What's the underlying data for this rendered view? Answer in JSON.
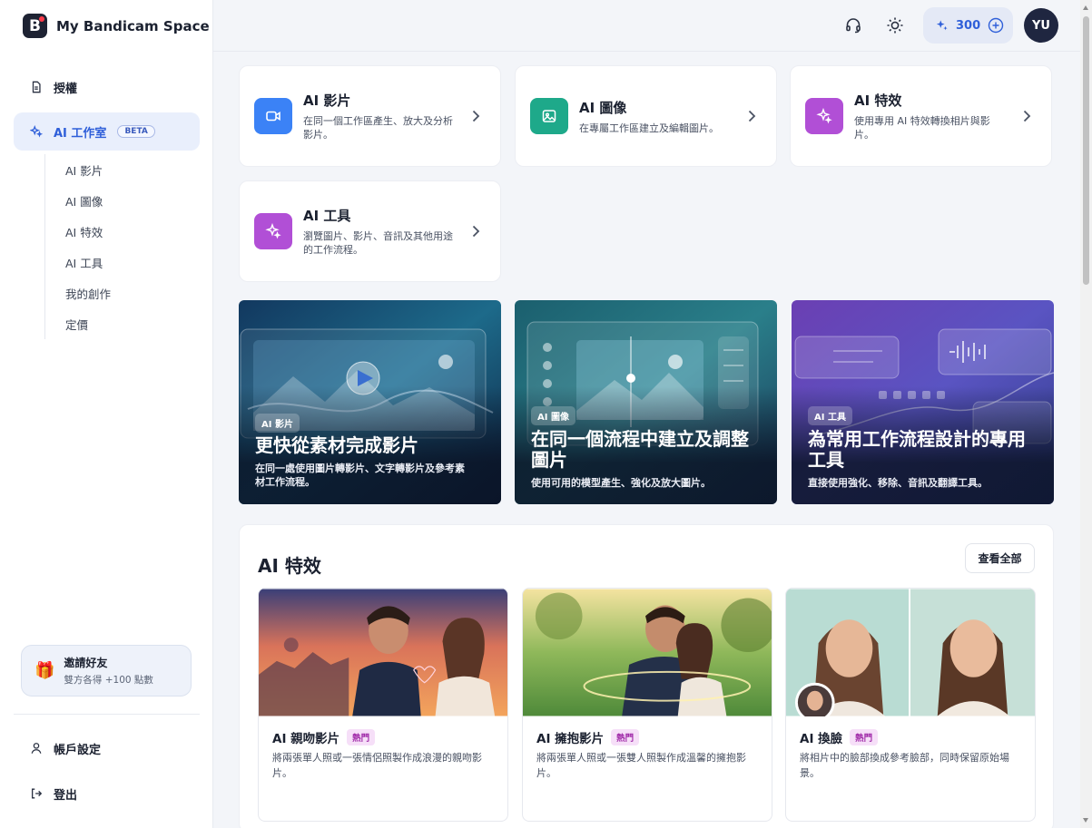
{
  "app": {
    "name": "My Bandicam Space"
  },
  "sidebar": {
    "license_label": "授權",
    "studio_label": "AI 工作室",
    "studio_badge": "BETA",
    "subitems": [
      "AI 影片",
      "AI 圖像",
      "AI 特效",
      "AI 工具",
      "我的創作",
      "定價"
    ],
    "invite": {
      "title": "邀請好友",
      "subtitle": "雙方各得 +100 點數"
    },
    "account_label": "帳戶設定",
    "logout_label": "登出"
  },
  "topbar": {
    "credits": "300",
    "avatar_initials": "YU",
    "icons": [
      "headset-icon",
      "sun-icon",
      "sparkle-icon",
      "plus-circle-icon"
    ]
  },
  "tools": [
    {
      "title": "AI 影片",
      "desc": "在同一個工作區產生、放大及分析影片。",
      "icon": "video-icon",
      "color": "#3b82f6"
    },
    {
      "title": "AI 圖像",
      "desc": "在專屬工作區建立及編輯圖片。",
      "icon": "image-icon",
      "color": "#1ea98a"
    },
    {
      "title": "AI 特效",
      "desc": "使用專用 AI 特效轉換相片與影片。",
      "icon": "sparkle-icon",
      "color": "#b14fd6"
    },
    {
      "title": "AI 工具",
      "desc": "瀏覽圖片、影片、音訊及其他用途的工作流程。",
      "icon": "sparkle-icon",
      "color": "#b14fd6"
    }
  ],
  "banners": [
    {
      "tag": "AI 影片",
      "title": "更快從素材完成影片",
      "desc": "在同一處使用圖片轉影片、文字轉影片及參考素材工作流程。"
    },
    {
      "tag": "AI 圖像",
      "title": "在同一個流程中建立及調整圖片",
      "desc": "使用可用的模型產生、強化及放大圖片。"
    },
    {
      "tag": "AI 工具",
      "title": "為常用工作流程設計的專用工具",
      "desc": "直接使用強化、移除、音訊及翻譯工具。"
    }
  ],
  "effects": {
    "title": "AI 特效",
    "view_all": "查看全部",
    "cards": [
      {
        "title": "AI 親吻影片",
        "badge": "熱門",
        "desc": "將兩張單人照或一張情侶照製作成浪漫的親吻影片。"
      },
      {
        "title": "AI 擁抱影片",
        "badge": "熱門",
        "desc": "將兩張單人照或一張雙人照製作成溫馨的擁抱影片。"
      },
      {
        "title": "AI 換臉",
        "badge": "熱門",
        "desc": "將相片中的臉部換成參考臉部，同時保留原始場景。"
      }
    ]
  }
}
